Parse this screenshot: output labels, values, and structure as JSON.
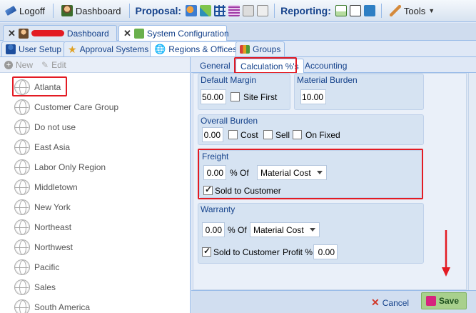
{
  "toolbar": {
    "logoff": "Logoff",
    "dashboard": "Dashboard",
    "proposal_label": "Proposal:",
    "reporting_label": "Reporting:",
    "tools": "Tools"
  },
  "tabs": [
    {
      "label": "Dashboard"
    },
    {
      "label": "System Configuration"
    }
  ],
  "subtabs": [
    "User Setup",
    "Approval Systems",
    "Regions & Offices",
    "Groups"
  ],
  "left": {
    "new_label": "New",
    "edit_label": "Edit",
    "items": [
      "Atlanta",
      "Customer Care Group",
      "Do not use",
      "East Asia",
      "Labor Only Region",
      "Middletown",
      "New York",
      "Northeast",
      "Northwest",
      "Pacific",
      "Sales",
      "South America"
    ]
  },
  "content_tabs": [
    "General",
    "Calculation %'s",
    "Accounting"
  ],
  "form": {
    "default_margin": {
      "title": "Default Margin",
      "value": "50.00",
      "site_first": "Site First"
    },
    "material_burden": {
      "title": "Material Burden",
      "value": "10.00"
    },
    "overall_burden": {
      "title": "Overall Burden",
      "value": "0.00",
      "cost": "Cost",
      "sell": "Sell",
      "on_fixed": "On Fixed"
    },
    "freight": {
      "title": "Freight",
      "value": "0.00",
      "pct_of": "% Of",
      "basis": "Material Cost",
      "sold_to_customer": "Sold to Customer"
    },
    "warranty": {
      "title": "Warranty",
      "value": "0.00",
      "pct_of": "% Of",
      "basis": "Material Cost",
      "sold_to_customer": "Sold to Customer",
      "profit_label": "Profit %",
      "profit_value": "0.00"
    }
  },
  "buttons": {
    "cancel": "Cancel",
    "save": "Save"
  },
  "colors": {
    "accent": "#15428b",
    "highlight": "#e31b23",
    "save_bg": "#a8d08d"
  }
}
